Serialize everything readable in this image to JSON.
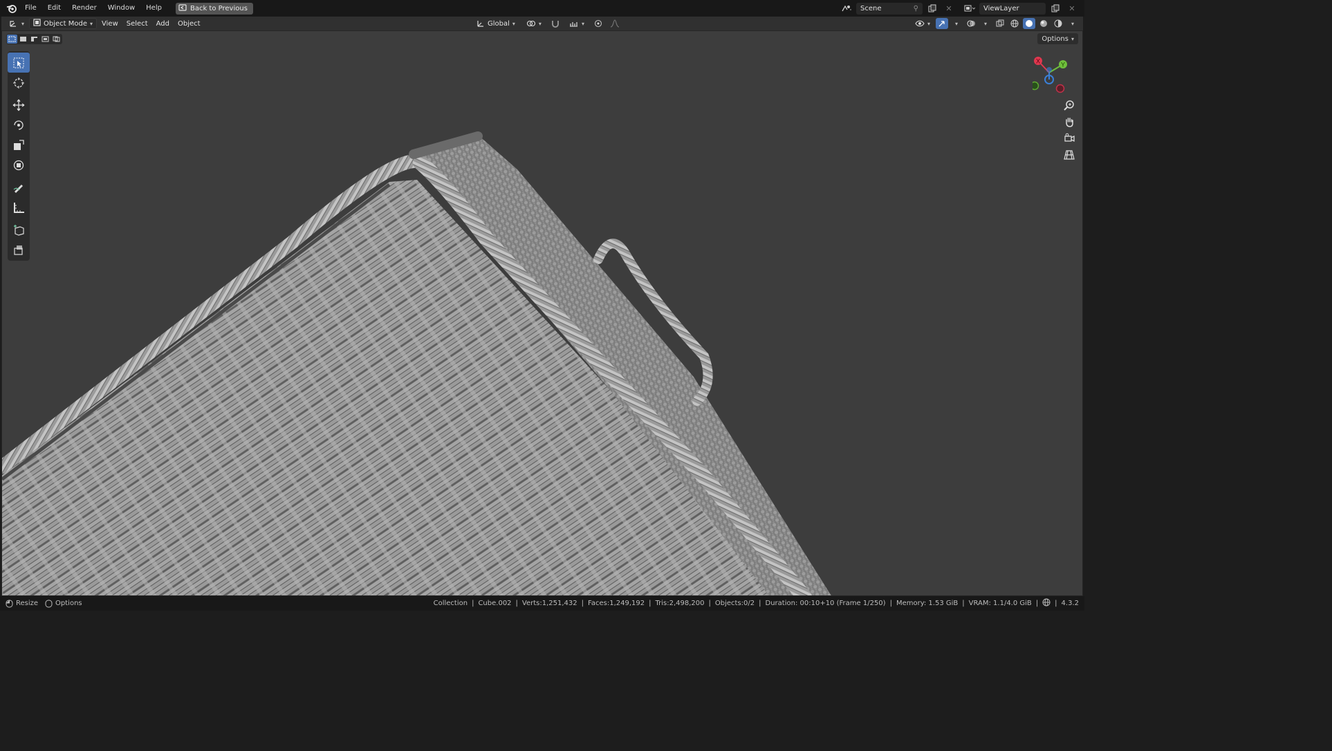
{
  "menubar": {
    "items": [
      "File",
      "Edit",
      "Render",
      "Window",
      "Help"
    ],
    "back_button": "Back to Previous",
    "scene_field": "Scene",
    "viewlayer_field": "ViewLayer"
  },
  "viewport_header": {
    "mode": "Object Mode",
    "menus": [
      "View",
      "Select",
      "Add",
      "Object"
    ],
    "transform_orientation": "Global",
    "options_label": "Options"
  },
  "statusbar": {
    "resize": "Resize",
    "options": "Options",
    "collection": "Collection",
    "object": "Cube.002",
    "verts": "Verts:1,251,432",
    "faces": "Faces:1,249,192",
    "tris": "Tris:2,498,200",
    "objects": "Objects:0/2",
    "duration": "Duration: 00:10+10 (Frame 1/250)",
    "memory": "Memory: 1.53 GiB",
    "vram": "VRAM: 1.1/4.0 GiB",
    "version": "4.3.2"
  },
  "gizmo": {
    "x_label": "X",
    "y_label": "Y",
    "x_color": "#e0384f",
    "y_color": "#6fbf3c",
    "z_color": "#3a80d8"
  },
  "colors": {
    "accent": "#4772b3",
    "viewport_bg": "#3d3d3d",
    "mesh": "#8f8f8f"
  }
}
